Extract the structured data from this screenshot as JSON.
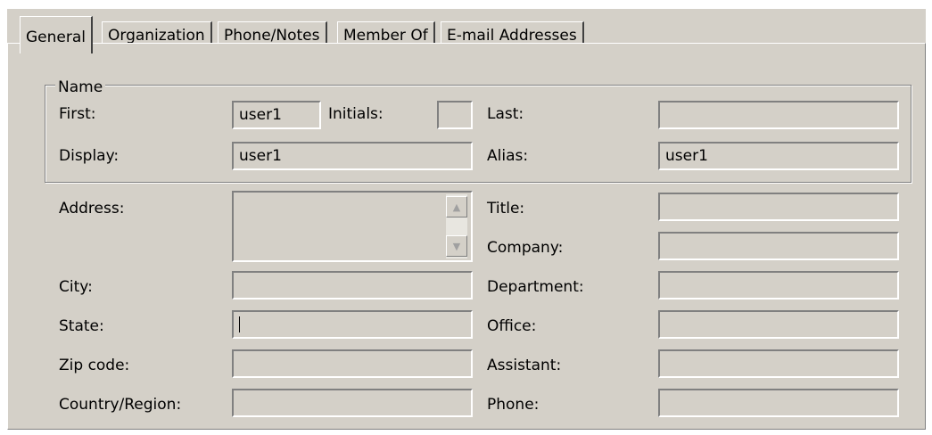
{
  "tabs": [
    {
      "label": "General",
      "active": true
    },
    {
      "label": "Organization"
    },
    {
      "label": "Phone/Notes"
    },
    {
      "label": "Member Of"
    },
    {
      "label": "E-mail Addresses"
    }
  ],
  "name_group": {
    "title": "Name",
    "first_label": "First:",
    "first_value": "user1",
    "initials_label": "Initials:",
    "initials_value": "",
    "last_label": "Last:",
    "last_value": "",
    "display_label": "Display:",
    "display_value": "user1",
    "alias_label": "Alias:",
    "alias_value": "user1"
  },
  "left_fields": {
    "address_label": "Address:",
    "address_value": "",
    "city_label": "City:",
    "city_value": "",
    "state_label": "State:",
    "state_value": "",
    "zip_label": "Zip code:",
    "zip_value": "",
    "country_label": "Country/Region:",
    "country_value": ""
  },
  "right_fields": {
    "title_label": "Title:",
    "title_value": "",
    "company_label": "Company:",
    "company_value": "",
    "department_label": "Department:",
    "department_value": "",
    "office_label": "Office:",
    "office_value": "",
    "assistant_label": "Assistant:",
    "assistant_value": "",
    "phone_label": "Phone:",
    "phone_value": ""
  },
  "icons": {
    "scroll_up": "scroll-up-arrow-icon",
    "scroll_down": "scroll-down-arrow-icon"
  }
}
